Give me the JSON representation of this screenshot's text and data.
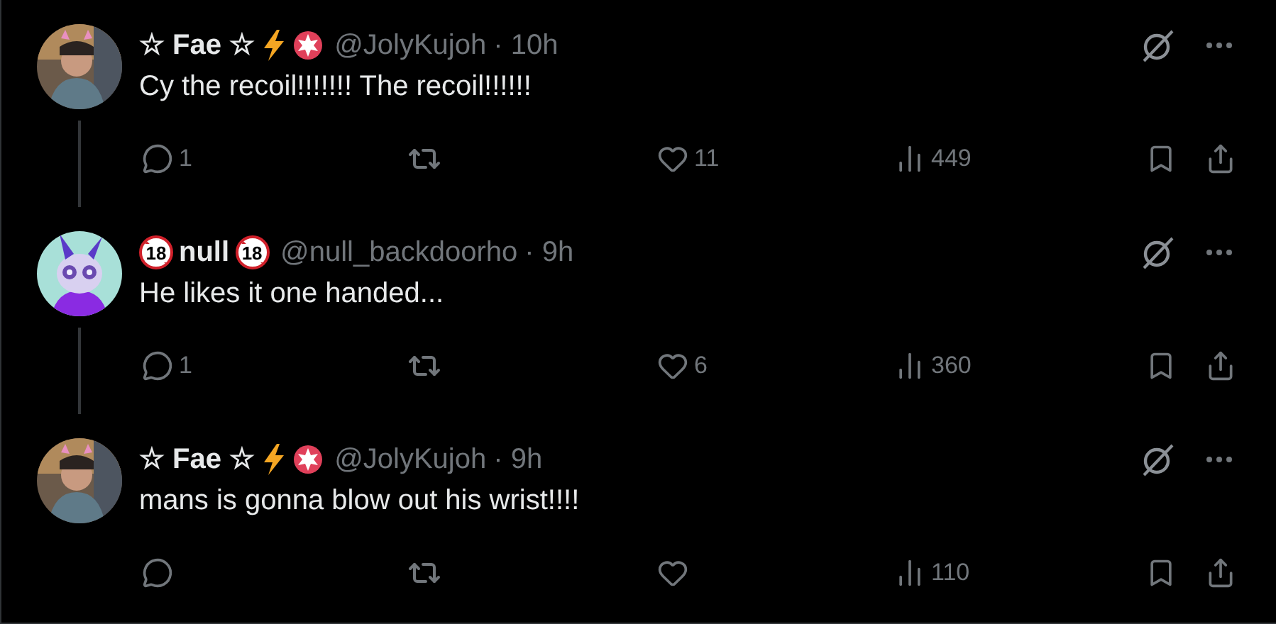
{
  "tweets": [
    {
      "name_parts": [
        {
          "kind": "text",
          "text": "☆ Fae ☆"
        },
        {
          "kind": "bolt"
        },
        {
          "kind": "flower"
        }
      ],
      "handle": "@JolyKujoh",
      "time": "· 10h",
      "text": "Cy the recoil!!!!!!! The recoil!!!!!!",
      "replies": "1",
      "likes": "11",
      "views": "449",
      "thread_line": true
    },
    {
      "name_parts": [
        {
          "kind": "no18",
          "text": "18"
        },
        {
          "kind": "text",
          "text": "null"
        },
        {
          "kind": "no18",
          "text": "18"
        }
      ],
      "handle": "@null_backdoorho",
      "time": "· 9h",
      "text": "He likes it one handed...",
      "replies": "1",
      "likes": "6",
      "views": "360",
      "thread_line": true
    },
    {
      "name_parts": [
        {
          "kind": "text",
          "text": "☆ Fae ☆"
        },
        {
          "kind": "bolt"
        },
        {
          "kind": "flower"
        }
      ],
      "handle": "@JolyKujoh",
      "time": "· 9h",
      "text": "mans is gonna blow out his wrist!!!!",
      "views": "110",
      "thread_line": false
    }
  ]
}
